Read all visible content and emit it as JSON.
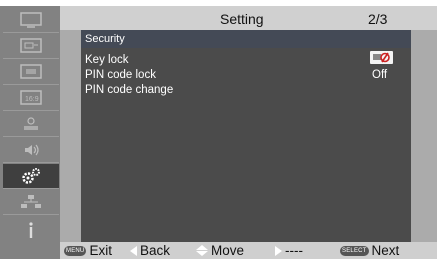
{
  "title": "Setting",
  "page_indicator": "2/3",
  "section_title": "Security",
  "settings": [
    {
      "label": "Key lock",
      "value": "",
      "value_icon": "key-lock-icon"
    },
    {
      "label": "PIN code lock",
      "value": "Off"
    },
    {
      "label": "PIN code change",
      "value": ""
    }
  ],
  "sidebar_icons": [
    "monitor-icon",
    "input-select-icon",
    "image-adjust-icon",
    "screen-icon",
    "display-setting-icon",
    "sound-icon",
    "setting-gear-icon",
    "network-icon",
    "info-icon"
  ],
  "footer": {
    "exit_badge": "MENU",
    "exit_label": "Exit",
    "back_label": "Back",
    "move_label": "Move",
    "dashes": "----",
    "next_badge": "SELECT",
    "next_label": "Next"
  },
  "colors": {
    "sidebar": "#828282",
    "selected": "#3f3f3f",
    "panel": "#4b4b4b",
    "panel_header": "#444a56",
    "titlebar": "#d0d0d0",
    "key_icon_accent": "#cc2222"
  }
}
